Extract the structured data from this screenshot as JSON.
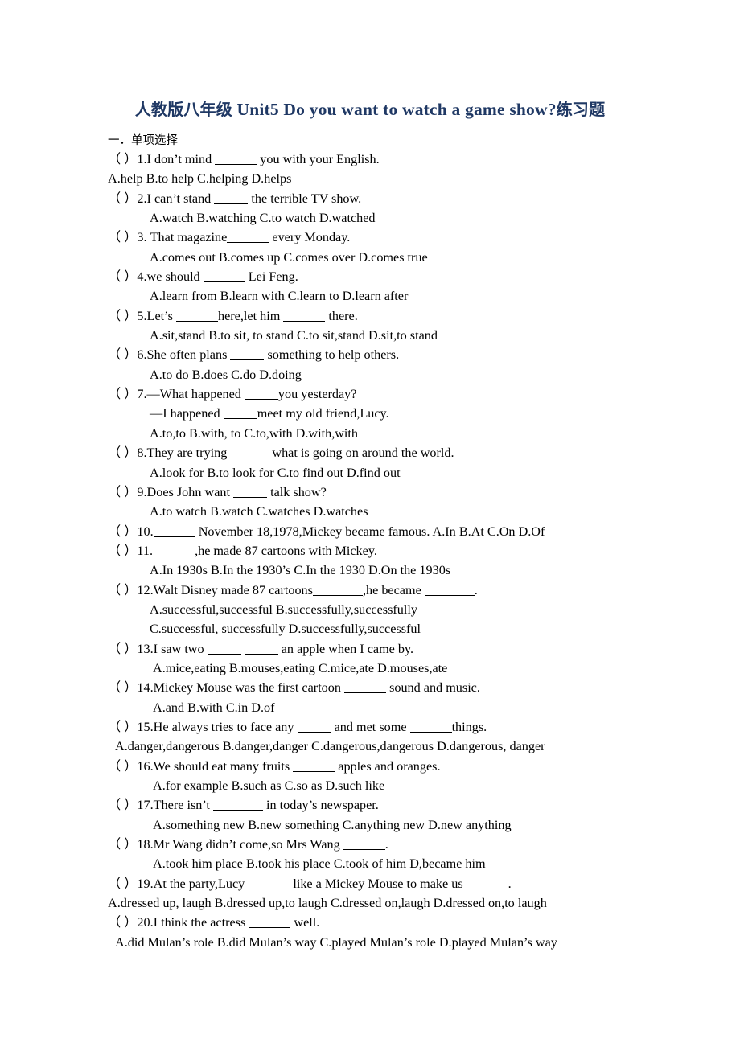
{
  "document": {
    "title_cn_prefix": "人教版八年级",
    "title_en": "Unit5 Do you want to watch a game show?",
    "title_cn_suffix": "练习题",
    "title_full": "人教版八年级 Unit5 Do you want to watch a game show?练习题",
    "title_color": "#1F3864",
    "section_heading": "一．单项选择"
  },
  "lines": [
    {
      "indent": "i0",
      "text": "（   ）1.I don’t mind  ______  you with your English."
    },
    {
      "indent": "i0",
      "text": "A.help       B.to help       C.helping       D.helps"
    },
    {
      "indent": "i0",
      "text": "（   ）2.I can’t stand  _____  the terrible TV show."
    },
    {
      "indent": "i3",
      "text": "A.watch        B.watching        C.to watch      D.watched"
    },
    {
      "indent": "i0",
      "text": "（   ）3. That magazine______ every Monday."
    },
    {
      "indent": "i3",
      "text": "A.comes out     B.comes up       C.comes over       D.comes true"
    },
    {
      "indent": "i0",
      "text": "（   ）4.we should  ______  Lei Feng."
    },
    {
      "indent": "i3",
      "text": "A.learn from        B.learn with        C.learn to       D.learn after"
    },
    {
      "indent": "i0",
      "text": "（   ）5.Let’s  ______here,let him  ______  there."
    },
    {
      "indent": "i3",
      "text": "A.sit,stand       B.to sit, to stand     C.to sit,stand     D.sit,to stand"
    },
    {
      "indent": "i0",
      "text": "（   ）6.She often plans  _____  something to help others."
    },
    {
      "indent": "i3",
      "text": "A.to do      B.does       C.do        D.doing"
    },
    {
      "indent": "i0",
      "text": "（   ）7.—What happened  _____you yesterday?"
    },
    {
      "indent": "i3",
      "text": "—I happened  _____meet my old friend,Lucy."
    },
    {
      "indent": "i3",
      "text": "A.to,to      B.with, to      C.to,with      D.with,with"
    },
    {
      "indent": "i0",
      "text": "（   ）8.They are trying  ______what is going on around the world."
    },
    {
      "indent": "i3",
      "text": "A.look for      B.to look for      C.to find out    D.find out"
    },
    {
      "indent": "i0",
      "text": "（   ）9.Does John want  _____  talk show?"
    },
    {
      "indent": "i3",
      "text": "A.to watch        B.watch        C.watches       D.watches"
    },
    {
      "indent": "i0",
      "text": "（   ）10.______  November 18,1978,Mickey became famous.   A.In    B.At   C.On   D.Of"
    },
    {
      "indent": "i0",
      "text": "（   ）11.______,he made 87 cartoons with Mickey."
    },
    {
      "indent": "i3",
      "text": "A.In 1930s        B.In the 1930’s        C.In the 1930       D.On the 1930s"
    },
    {
      "indent": "i0",
      "text": "（   ）12.Walt Disney made 87 cartoons_______,he became  _______."
    },
    {
      "indent": "i3",
      "text": "A.successful,successful         B.successfully,successfully"
    },
    {
      "indent": "i3",
      "text": "C.successful, successfully     D.successfully,successful"
    },
    {
      "indent": "i0",
      "text": "（   ）13.I saw two  _____  _____  an apple when I came by."
    },
    {
      "indent": "i4",
      "text": "A.mice,eating      B.mouses,eating        C.mice,ate     D.mouses,ate"
    },
    {
      "indent": "i0",
      "text": "（   ）14.Mickey Mouse was the first cartoon  ______  sound and music."
    },
    {
      "indent": "i4",
      "text": "A.and      B.with      C.in       D.of"
    },
    {
      "indent": "i0",
      "text": "（   ）15.He always tries to face any  _____  and met some  ______things."
    },
    {
      "indent": "i1",
      "text": "A.danger,dangerous       B.danger,danger        C.dangerous,dangerous    D.dangerous, danger"
    },
    {
      "indent": "i0",
      "text": "（   ）16.We should eat many fruits  ______  apples and oranges."
    },
    {
      "indent": "i4",
      "text": "A.for example       B.such as       C.so as      D.such like"
    },
    {
      "indent": "i0",
      "text": "（   ）17.There isn’t  _______  in today’s newspaper."
    },
    {
      "indent": "i4",
      "text": "A.something new         B.new something   C.anything new           D.new anything"
    },
    {
      "indent": "i0",
      "text": "（   ）18.Mr Wang didn’t come,so Mrs Wang  ______."
    },
    {
      "indent": "i4",
      "text": "A.took him place       B.took his place    C.took of him          D,became him"
    },
    {
      "indent": "i0",
      "text": "（   ）19.At the party,Lucy  ______  like a Mickey Mouse to make us  ______."
    },
    {
      "indent": "i0",
      "text": "A.dressed up, laugh      B.dressed up,to laugh   C.dressed on,laugh        D.dressed on,to laugh"
    },
    {
      "indent": "i0",
      "text": "（   ）20.I think the actress  ______  well."
    },
    {
      "indent": "i1",
      "text": "A.did Mulan’s role        B.did Mulan’s way    C.played Mulan’s role    D.played Mulan’s way"
    }
  ]
}
